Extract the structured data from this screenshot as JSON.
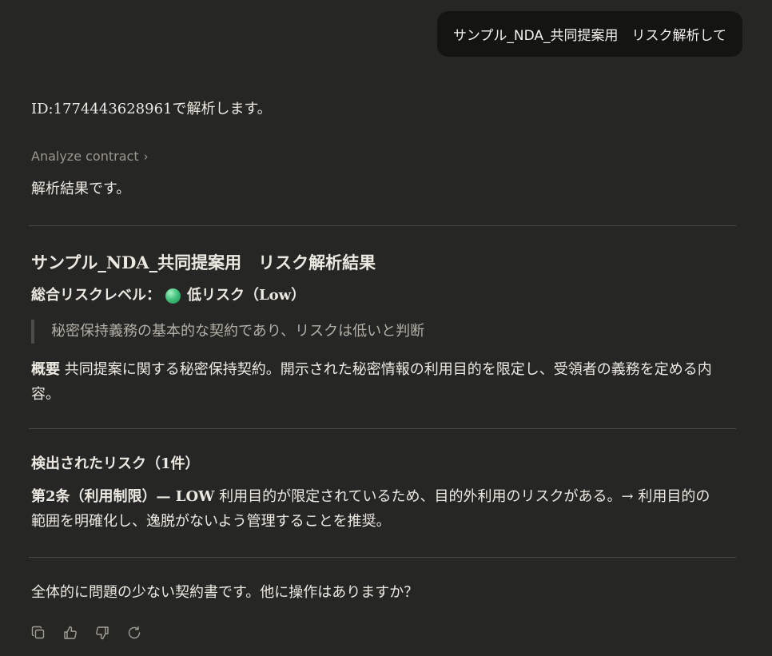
{
  "user_message": "サンプル_NDA_共同提案用　リスク解析して",
  "assistant": {
    "intro": "ID:1774443628961で解析します。",
    "tool_call": {
      "label": "Analyze contract",
      "chevron": "›"
    },
    "result_intro": "解析結果です。",
    "report": {
      "title": "サンプル_NDA_共同提案用　リスク解析結果",
      "overall_label": "総合リスクレベル：",
      "overall_value": "低リスク（Low）",
      "overall_color": "#43c47e",
      "quote": "秘密保持義務の基本的な契約であり、リスクは低いと判断",
      "summary_label": "概要",
      "summary_text": " 共同提案に関する秘密保持契約。開示された秘密情報の利用目的を限定し、受領者の義務を定める内容。",
      "risks_heading": "検出されたリスク（1件）",
      "risk_item": {
        "label": "第2条（利用制限）— LOW",
        "text": " 利用目的が限定されているため、目的外利用のリスクがある。→ 利用目的の範囲を明確化し、逸脱がないよう管理することを推奨。"
      }
    },
    "closing": "全体的に問題の少ない契約書です。他に操作はありますか？"
  },
  "actions": [
    {
      "name": "copy-icon"
    },
    {
      "name": "thumbs-up-icon"
    },
    {
      "name": "thumbs-down-icon"
    },
    {
      "name": "retry-icon"
    }
  ],
  "colors": {
    "background": "#262624",
    "user_bubble": "#141413",
    "text": "#ece9e2",
    "muted": "#9a978f",
    "divider": "#4a4945"
  }
}
